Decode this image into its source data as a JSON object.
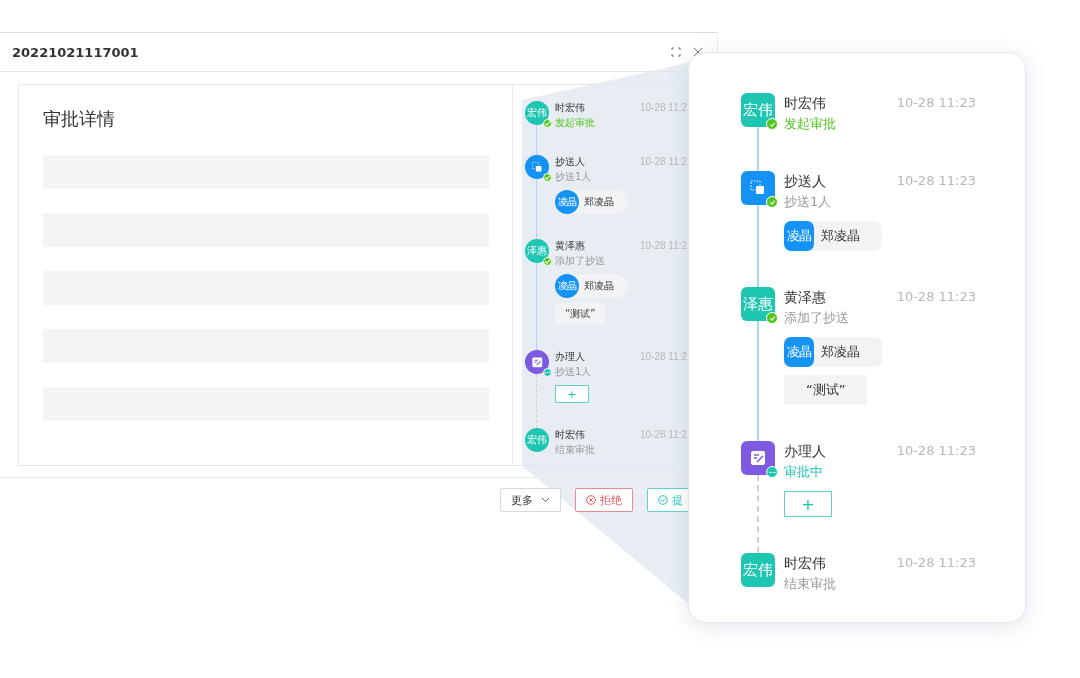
{
  "window": {
    "title": "20221021117001"
  },
  "detail": {
    "title": "审批详情"
  },
  "timeline": [
    {
      "avatar": {
        "kind": "text",
        "text": "宏伟",
        "color": "#1ec6b2"
      },
      "badge": {
        "kind": "check"
      },
      "name": "时宏伟",
      "status": {
        "kind": "success",
        "text": "发起审批"
      },
      "time": "10-28 11:2",
      "connector": {
        "kind": "solid"
      }
    },
    {
      "avatar": {
        "kind": "copy",
        "color": "#1593f5"
      },
      "badge": {
        "kind": "check"
      },
      "name": "抄送人",
      "status": {
        "kind": "muted",
        "text": "抄送1人"
      },
      "time": "10-28 11:2",
      "connector": {
        "kind": "solid"
      },
      "attachments": [
        {
          "kind": "person",
          "avatar_text": "凌晶",
          "name": "郑凌晶"
        }
      ]
    },
    {
      "avatar": {
        "kind": "text",
        "text": "泽惠",
        "color": "#1ec6b2"
      },
      "badge": {
        "kind": "check"
      },
      "name": "黄泽惠",
      "status": {
        "kind": "muted",
        "text": "添加了抄送"
      },
      "time": "10-28 11:2",
      "connector": {
        "kind": "solid"
      },
      "attachments": [
        {
          "kind": "person",
          "avatar_text": "凌晶",
          "name": "郑凌晶"
        },
        {
          "kind": "comment",
          "text": "“测试”"
        }
      ]
    },
    {
      "avatar": {
        "kind": "handler",
        "color": "#7d5ae0"
      },
      "badge": {
        "kind": "dots"
      },
      "name": "办理人",
      "status": {
        "kind": "muted",
        "text": "抄送1人"
      },
      "time": "10-28 11:2",
      "connector": {
        "kind": "dashed"
      },
      "attachments": [
        {
          "kind": "add",
          "label": "+"
        }
      ]
    },
    {
      "avatar": {
        "kind": "text",
        "text": "宏伟",
        "color": "#1ec6b2"
      },
      "name": "时宏伟",
      "status": {
        "kind": "muted",
        "text": "结束审批"
      },
      "time": "10-28 11:2"
    }
  ],
  "buttons": [
    {
      "kind": "dropdown",
      "label": "更多"
    },
    {
      "kind": "danger",
      "label": "拒绝"
    },
    {
      "kind": "primary",
      "label": "提"
    }
  ],
  "callout": {
    "timeline": [
      {
        "avatar": {
          "kind": "text",
          "text": "宏伟",
          "color": "#1ec6b2"
        },
        "badge": {
          "kind": "check"
        },
        "name": "时宏伟",
        "status": {
          "kind": "success",
          "text": "发起审批"
        },
        "time": "10-28 11:23",
        "connector": {
          "kind": "solid"
        }
      },
      {
        "avatar": {
          "kind": "copy",
          "color": "#1593f5"
        },
        "badge": {
          "kind": "check"
        },
        "name": "抄送人",
        "status": {
          "kind": "muted",
          "text": "抄送1人"
        },
        "time": "10-28 11:23",
        "connector": {
          "kind": "solid"
        },
        "attachments": [
          {
            "kind": "person",
            "avatar_text": "凌晶",
            "name": "郑凌晶"
          }
        ]
      },
      {
        "avatar": {
          "kind": "text",
          "text": "泽惠",
          "color": "#1ec6b2"
        },
        "badge": {
          "kind": "check"
        },
        "name": "黄泽惠",
        "status": {
          "kind": "muted",
          "text": "添加了抄送"
        },
        "time": "10-28 11:23",
        "connector": {
          "kind": "solid"
        },
        "attachments": [
          {
            "kind": "person",
            "avatar_text": "凌晶",
            "name": "郑凌晶"
          },
          {
            "kind": "comment",
            "text": "“测试”"
          }
        ]
      },
      {
        "avatar": {
          "kind": "handler",
          "color": "#7d5ae0"
        },
        "badge": {
          "kind": "dots"
        },
        "name": "办理人",
        "status": {
          "kind": "active",
          "text": "审批中"
        },
        "time": "10-28 11:23",
        "connector": {
          "kind": "dashed"
        },
        "attachments": [
          {
            "kind": "add",
            "label": "+"
          }
        ]
      },
      {
        "avatar": {
          "kind": "text",
          "text": "宏伟",
          "color": "#1ec6b2"
        },
        "name": "时宏伟",
        "status": {
          "kind": "muted",
          "text": "结束审批"
        },
        "time": "10-28 11:23"
      }
    ]
  }
}
